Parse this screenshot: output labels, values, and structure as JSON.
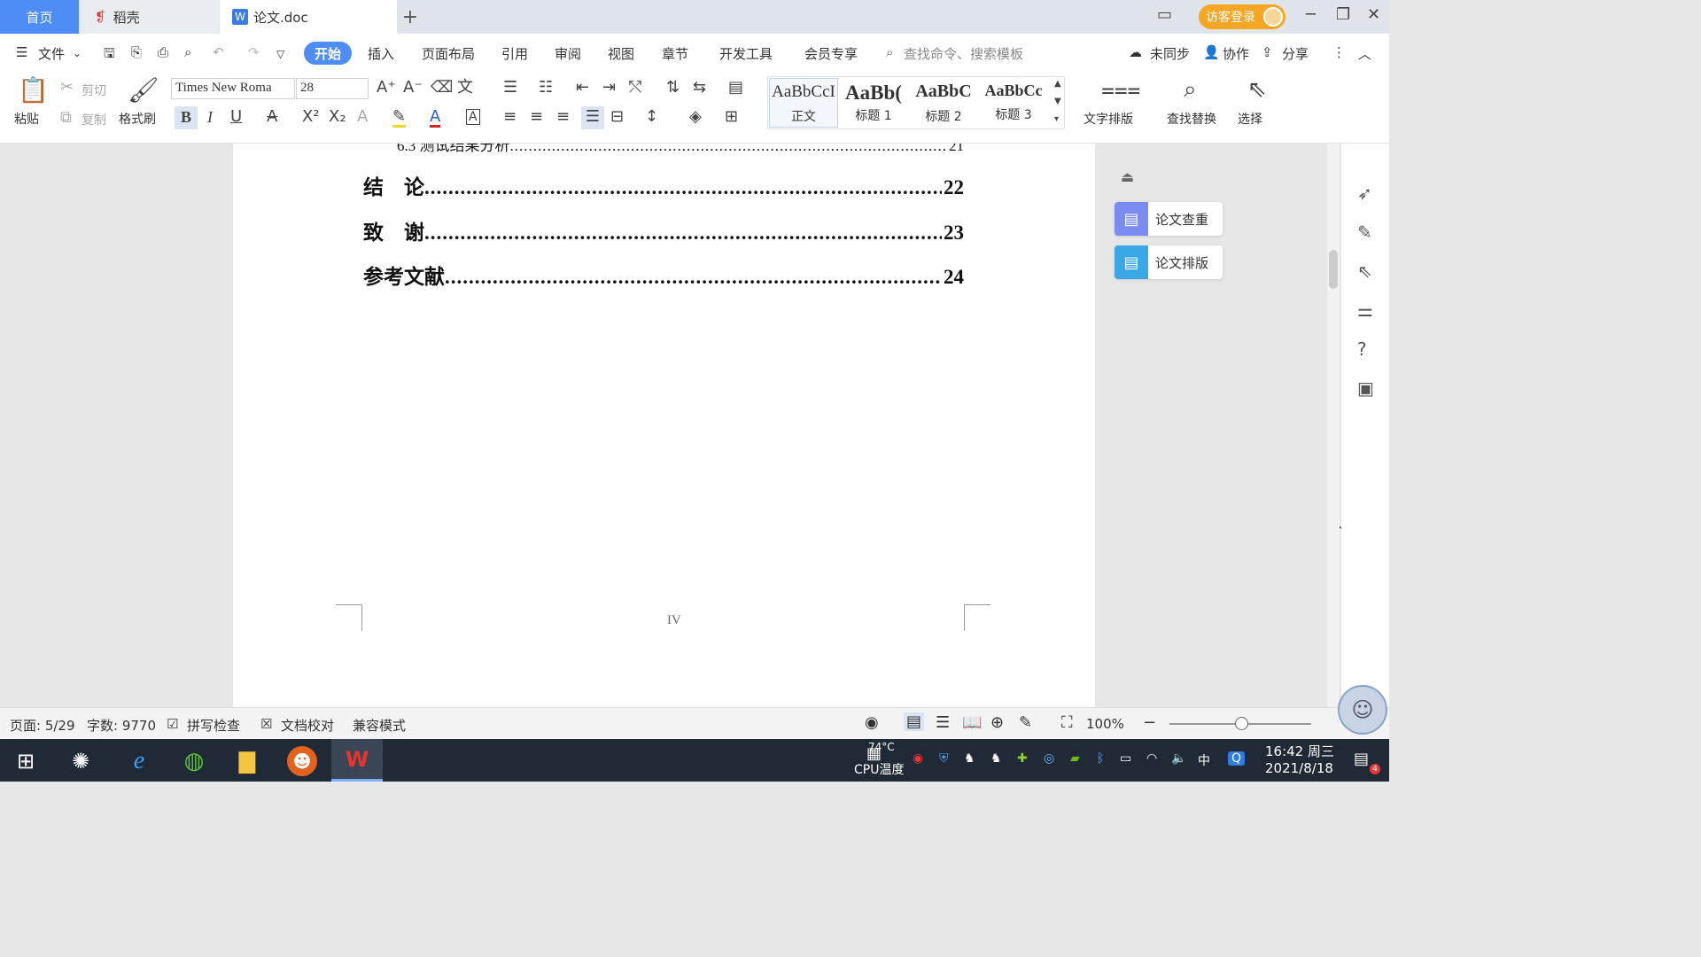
{
  "tabs": {
    "home": "首页",
    "daoke": "稻壳",
    "doc": "论文.doc",
    "add": "+"
  },
  "header": {
    "visitor_login": "访客登录"
  },
  "menu": {
    "file": "文件",
    "start": "开始",
    "items": [
      "插入",
      "页面布局",
      "引用",
      "审阅",
      "视图",
      "章节",
      "开发工具",
      "会员专享"
    ],
    "search_placeholder": "查找命令、搜索模板",
    "unsynced": "未同步",
    "collab": "协作",
    "share": "分享"
  },
  "ribbon": {
    "paste": "粘贴",
    "cut": "剪切",
    "copy": "复制",
    "format_painter": "格式刷",
    "font_name": "Times New Roma",
    "font_size": "28",
    "styles": [
      {
        "preview": "AaBbCcI",
        "name": "正文"
      },
      {
        "preview": "AaBb(",
        "name": "标题 1"
      },
      {
        "preview": "AaBbC",
        "name": "标题 2"
      },
      {
        "preview": "AaBbCc",
        "name": "标题 3"
      }
    ],
    "text_layout": "文字排版",
    "find_replace": "查找替换",
    "select": "选择"
  },
  "document": {
    "partial_line": "6.3  测试结果分析",
    "partial_page": "21",
    "toc": [
      {
        "title": "结　论",
        "page": "22"
      },
      {
        "title": "致　谢",
        "page": "23"
      },
      {
        "title": "参考文献",
        "page": "24"
      }
    ],
    "page_footer": "IV"
  },
  "side_panel": {
    "check": "论文查重",
    "layout": "论文排版"
  },
  "status": {
    "page": "页面: 5/29",
    "words": "字数: 9770",
    "spell": "拼写检查",
    "proof": "文档校对",
    "compat": "兼容模式",
    "zoom": "100%"
  },
  "taskbar": {
    "cpu_temp": "74°C",
    "cpu_label": "CPU温度",
    "ime": "中",
    "time": "16:42 周三",
    "date": "2021/8/18",
    "notify_count": "4"
  }
}
